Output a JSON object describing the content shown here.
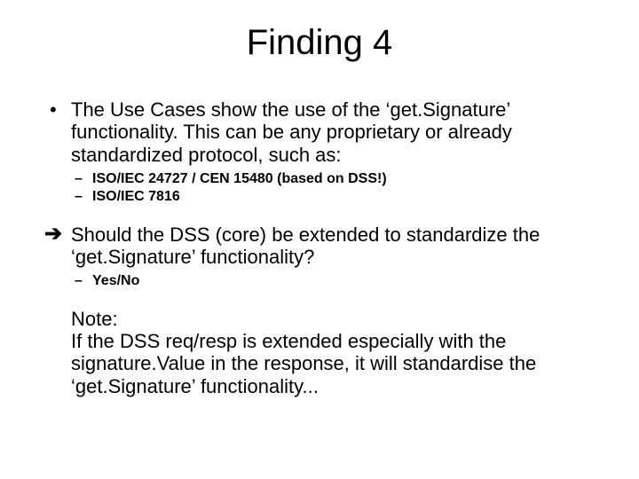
{
  "title": "Finding 4",
  "item1": {
    "text": "The Use Cases show the use of the ‘get.Signature’ functionality. This can be any proprietary or already standardized protocol, such as:",
    "sub": [
      "ISO/IEC 24727 / CEN 15480 (based on DSS!)",
      "ISO/IEC 7816"
    ]
  },
  "item2": {
    "text": "Should the DSS (core) be extended to standardize the ‘get.Signature’ functionality?",
    "sub": [
      "Yes/No"
    ]
  },
  "note": {
    "label": "Note:",
    "text": "If the DSS req/resp is extended especially with the signature.Value in the response, it will standardise the ‘get.Signature’ functionality..."
  }
}
